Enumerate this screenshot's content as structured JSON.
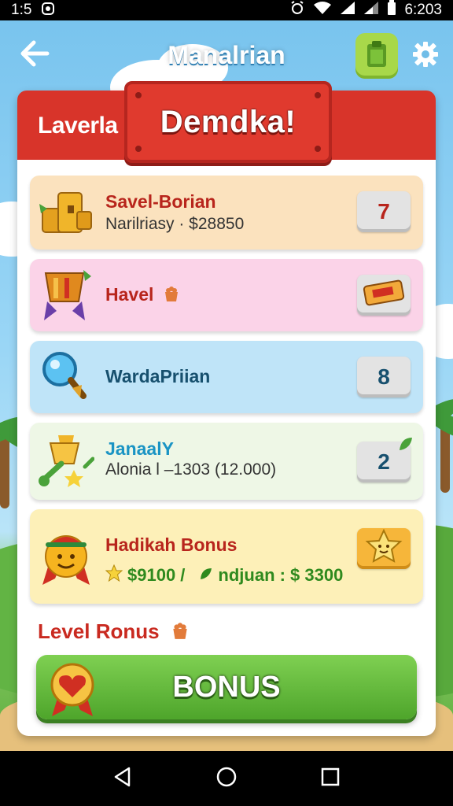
{
  "status_bar": {
    "time_left": "1:5",
    "time_right": "6:203",
    "icons": [
      "notification-icon",
      "alarm-icon",
      "wifi-icon",
      "signal-icon",
      "signal-icon",
      "battery-icon"
    ]
  },
  "app_bar": {
    "title": "Manalrian",
    "back_icon": "arrow-left-icon",
    "clipboard_icon": "clipboard-icon",
    "settings_icon": "gear-icon"
  },
  "panel": {
    "header_label": "Laverla",
    "banner_text": "Demdka!",
    "rows": [
      {
        "title": "Savel-Borian",
        "subtitle": "Narilriasy · $28850",
        "badge": "7",
        "icon": "treasure-chest-icon"
      },
      {
        "title": "Havel",
        "subtitle": "",
        "badge": "",
        "icon": "trophy-icon",
        "badge_icon": "golden-ticket-icon"
      },
      {
        "title": "WardaPriian",
        "subtitle": "",
        "badge": "8",
        "icon": "magnifier-icon"
      },
      {
        "title": "JanaalY",
        "subtitle": "Alonia l –1303 (12.000)",
        "badge": "2",
        "icon": "trophy-key-icon"
      },
      {
        "title": "Hadikah Bonus",
        "subtitle_left": "$9100 /",
        "subtitle_right": "ndjuan : $ 3300",
        "icon": "smiley-medal-icon",
        "badge_icon": "star-face-icon"
      }
    ],
    "bonus_label": "Level Ronus",
    "bonus_button": "BONUS"
  },
  "colors": {
    "header_red": "#d8342a",
    "row_1": "#fbe2be",
    "row_2": "#fbd3e8",
    "row_3": "#bfe4f8",
    "row_4": "#eef7e6",
    "row_5": "#fdf0b8",
    "bonus_green": "#5cb836",
    "title_red": "#b8251c",
    "title_blue": "#17506e",
    "title_teal": "#1a94c4"
  },
  "nav_bar": [
    "back-triangle-icon",
    "home-circle-icon",
    "recents-square-icon"
  ]
}
